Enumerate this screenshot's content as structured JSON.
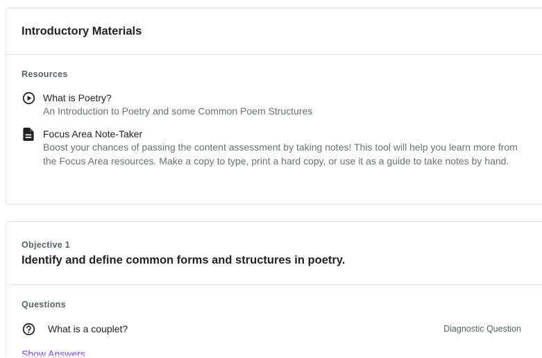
{
  "intro": {
    "title": "Introductory Materials",
    "resources_label": "Resources",
    "resources": [
      {
        "icon": "play-circle-icon",
        "title": "What is Poetry?",
        "description": "An Introduction to Poetry and some Common Poem Structures"
      },
      {
        "icon": "document-icon",
        "title": "Focus Area Note-Taker",
        "description": "Boost your chances of passing the content assessment by taking notes! This tool will help you learn more from the Focus Area resources. Make a copy to type, print a hard copy, or use it as a guide to take notes by hand."
      }
    ]
  },
  "objective": {
    "label": "Objective 1",
    "title": "Identify and define common forms and structures in poetry.",
    "questions_label": "Questions",
    "questions": [
      {
        "icon": "question-circle-icon",
        "text": "What is a couplet?",
        "type": "Diagnostic Question"
      }
    ],
    "show_answers_label": "Show Answers"
  },
  "colors": {
    "accent_link": "#7a35e0",
    "border": "#e2e2e2",
    "muted_text": "#6b6f75"
  }
}
